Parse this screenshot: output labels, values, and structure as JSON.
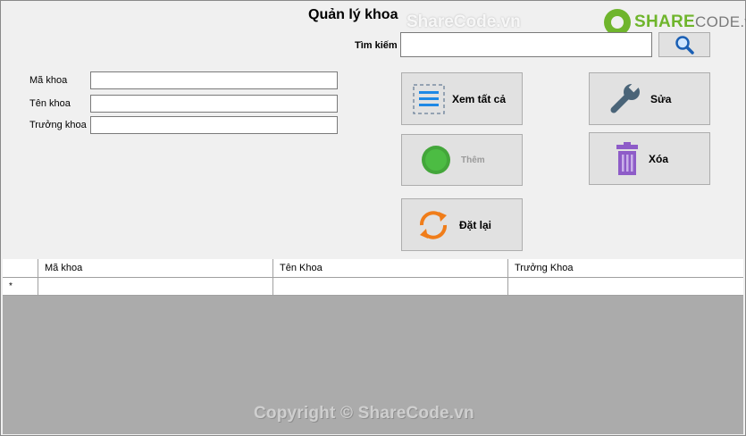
{
  "window": {
    "title": "Quản lý khoa"
  },
  "logo": {
    "brand_bold": "SHARE",
    "brand_rest": "CODE.vn"
  },
  "search": {
    "label": "Tìm kiếm",
    "value": ""
  },
  "form": {
    "ma_khoa_label": "Mã khoa",
    "ten_khoa_label": "Tên khoa",
    "truong_khoa_label": "Trưởng khoa",
    "ma_khoa_value": "",
    "ten_khoa_value": "",
    "truong_khoa_value": ""
  },
  "buttons": {
    "view_all": "Xem tất cả",
    "add": "Thêm",
    "reset": "Đặt lại",
    "edit": "Sửa",
    "delete": "Xóa"
  },
  "grid": {
    "columns": [
      "Mã khoa",
      "Tên Khoa",
      "Trưởng Khoa"
    ],
    "new_row_marker": "*"
  },
  "watermarks": {
    "top": "ShareCode.vn",
    "bottom": "Copyright © ShareCode.vn"
  },
  "colors": {
    "accent_green": "#6fb52c",
    "reset_orange": "#f07d1a",
    "delete_purple": "#8e5cc8",
    "list_blue": "#1e88e5"
  }
}
